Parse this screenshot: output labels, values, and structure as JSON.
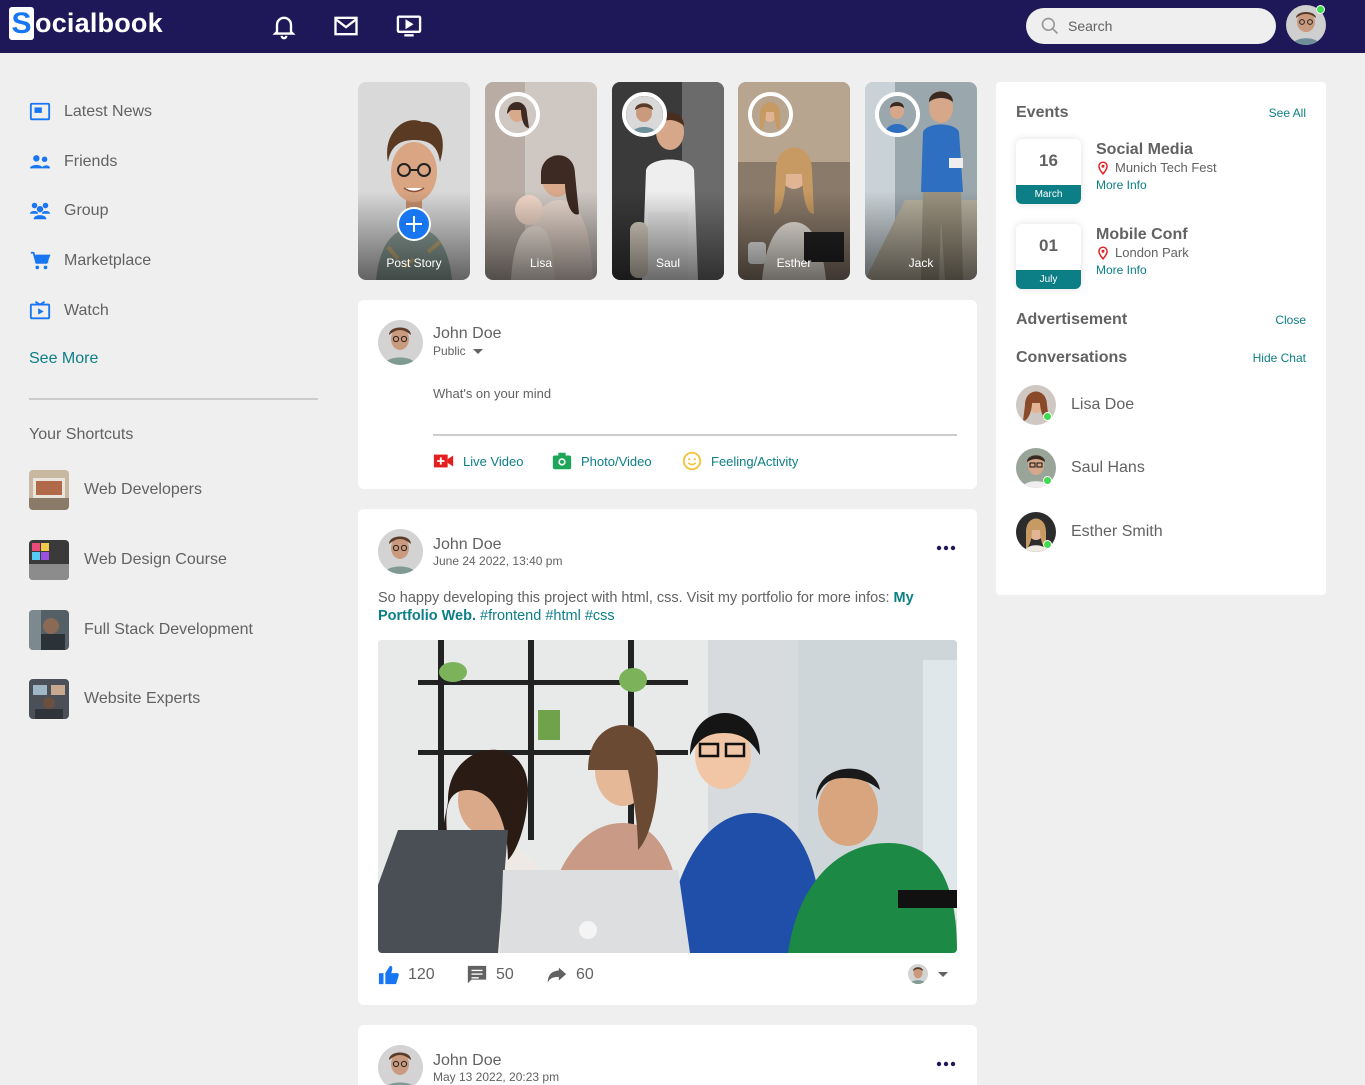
{
  "app": {
    "logo_letter": "S",
    "logo_rest": "ocialbook"
  },
  "navbar": {
    "icons": [
      "bell-icon",
      "mail-icon",
      "video-icon"
    ],
    "search_placeholder": "Search"
  },
  "sidebar": {
    "items": [
      {
        "label": "Latest News",
        "icon": "news-icon"
      },
      {
        "label": "Friends",
        "icon": "friends-icon"
      },
      {
        "label": "Group",
        "icon": "group-icon"
      },
      {
        "label": "Marketplace",
        "icon": "cart-icon"
      },
      {
        "label": "Watch",
        "icon": "watch-icon"
      }
    ],
    "see_more": "See More",
    "shortcuts_title": "Your Shortcuts",
    "shortcuts": [
      {
        "label": "Web Developers"
      },
      {
        "label": "Web Design Course"
      },
      {
        "label": "Full Stack Development"
      },
      {
        "label": "Website Experts"
      }
    ]
  },
  "stories": [
    {
      "name": "Post Story"
    },
    {
      "name": "Lisa"
    },
    {
      "name": "Saul"
    },
    {
      "name": "Esther"
    },
    {
      "name": "Jack"
    }
  ],
  "composer": {
    "user": "John Doe",
    "privacy": "Public",
    "placeholder": "What's on your mind",
    "actions": [
      {
        "label": "Live Video",
        "icon": "live-video-icon"
      },
      {
        "label": "Photo/Video",
        "icon": "camera-icon"
      },
      {
        "label": "Feeling/Activity",
        "icon": "smile-icon"
      }
    ]
  },
  "posts": [
    {
      "user": "John Doe",
      "date": "June 24 2022, 13:40 pm",
      "text": "So happy developing this project with html, css. Visit my portfolio for more infos: ",
      "link": "My Portfolio Web.",
      "tags": " #frontend #html #css",
      "likes": "120",
      "comments": "50",
      "shares": "60"
    },
    {
      "user": "John Doe",
      "date": "May 13 2022, 20:23 pm"
    }
  ],
  "events": {
    "title": "Events",
    "see_all": "See All",
    "items": [
      {
        "day": "16",
        "month": "March",
        "title": "Social Media",
        "location": "Munich Tech Fest",
        "more": "More Info"
      },
      {
        "day": "01",
        "month": "July",
        "title": "Mobile Conf",
        "location": "London Park",
        "more": "More Info"
      }
    ]
  },
  "advertisement": {
    "title": "Advertisement",
    "close": "Close"
  },
  "conversations": {
    "title": "Conversations",
    "hide": "Hide Chat",
    "items": [
      {
        "name": "Lisa Doe"
      },
      {
        "name": "Saul Hans"
      },
      {
        "name": "Esther Smith"
      }
    ]
  },
  "colors": {
    "navbar": "#1f1858",
    "accent": "#0c7f86",
    "brand_blue": "#1876f2",
    "online": "#41db51"
  }
}
